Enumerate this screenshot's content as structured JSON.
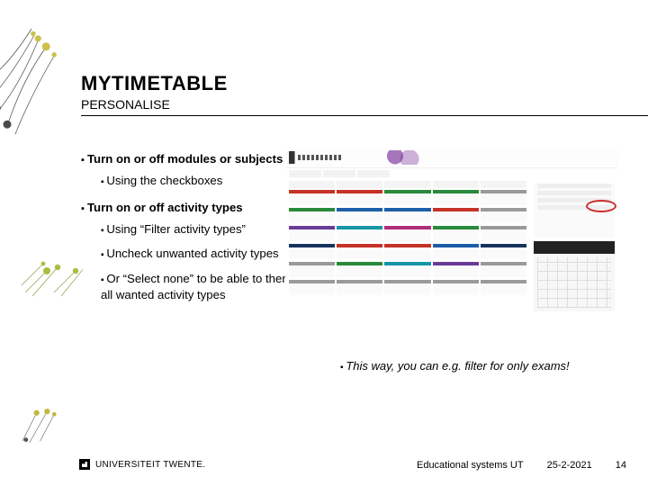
{
  "header": {
    "title": "MYTIMETABLE",
    "subtitle": "PERSONALISE"
  },
  "bullets": {
    "b1": "Turn on or off modules or subjects",
    "b1a": "Using the checkboxes",
    "b2": "Turn on or off activity types",
    "b2a": "Using “Filter activity types”",
    "b2b": "Uncheck unwanted activity types",
    "b2c": "Or “Select none” to be able to then check all wanted activity types"
  },
  "right": {
    "r1": "This way, you can e.g. filter for only exams!"
  },
  "footer": {
    "org": "UNIVERSITEIT TWENTE.",
    "center": "Educational systems UT",
    "date": "25-2-2021",
    "page": "14"
  }
}
